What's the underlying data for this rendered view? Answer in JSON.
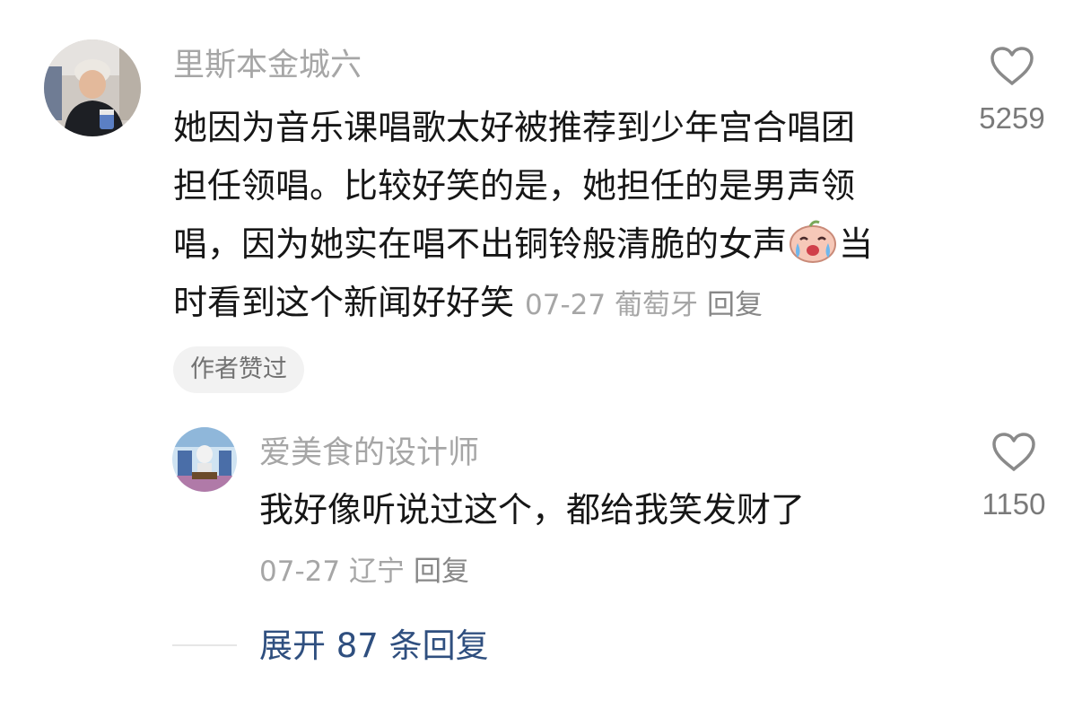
{
  "main_comment": {
    "username": "里斯本金城六",
    "text_lines": [
      "她因为音乐课唱歌太好被推荐到少年宫合唱团",
      "担任领唱。比较好笑的是，她担任的是男声领",
      "唱，因为她实在唱不出铜铃般清脆的女声",
      "当",
      "时看到这个新闻好好笑"
    ],
    "emoji": "crying-face-emoji",
    "date": "07-27",
    "location": "葡萄牙",
    "reply_label": "回复",
    "like_count": "5259",
    "author_badge": "作者赞过"
  },
  "reply_comment": {
    "username": "爱美食的设计师",
    "text": "我好像听说过这个，都给我笑发财了",
    "date": "07-27",
    "location": "辽宁",
    "reply_label": "回复",
    "like_count": "1150"
  },
  "expand": {
    "label": "展开 87 条回复"
  },
  "colors": {
    "text": "#161616",
    "muted": "#a6a6a6",
    "link": "#2f4f7f",
    "badge_bg": "#f2f2f2"
  }
}
